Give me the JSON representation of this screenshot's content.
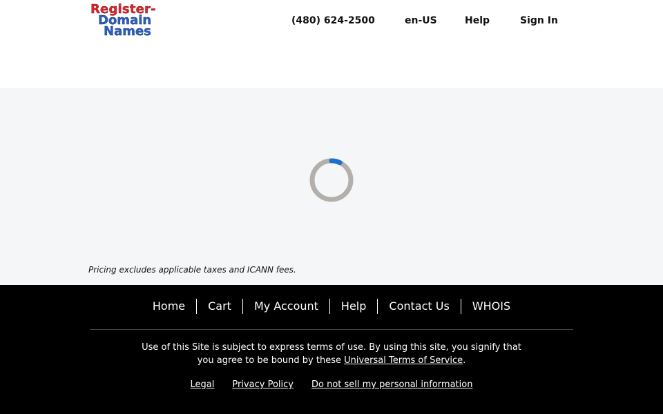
{
  "header": {
    "logo": {
      "line1": "Register-",
      "line2": "Domain",
      "line3": "Names"
    },
    "phone": "(480) 624-2500",
    "language": "en-US",
    "help": "Help",
    "sign_in": "Sign In"
  },
  "main": {
    "pricing_note": "Pricing excludes applicable taxes and ICANN fees.",
    "spinner": {
      "icon": "loading-spinner-icon",
      "track_color": "#b3b0ab",
      "accent_color": "#1f6fcf"
    }
  },
  "footer": {
    "nav": [
      "Home",
      "Cart",
      "My Account",
      "Help",
      "Contact Us",
      "WHOIS"
    ],
    "terms_text": "Use of this Site is subject to express terms of use. By using this site, you signify that you agree to be bound by these",
    "terms_link": "Universal Terms of Service",
    "terms_end": ".",
    "legal_links": [
      "Legal",
      "Privacy Policy",
      "Do not sell my personal information"
    ]
  }
}
